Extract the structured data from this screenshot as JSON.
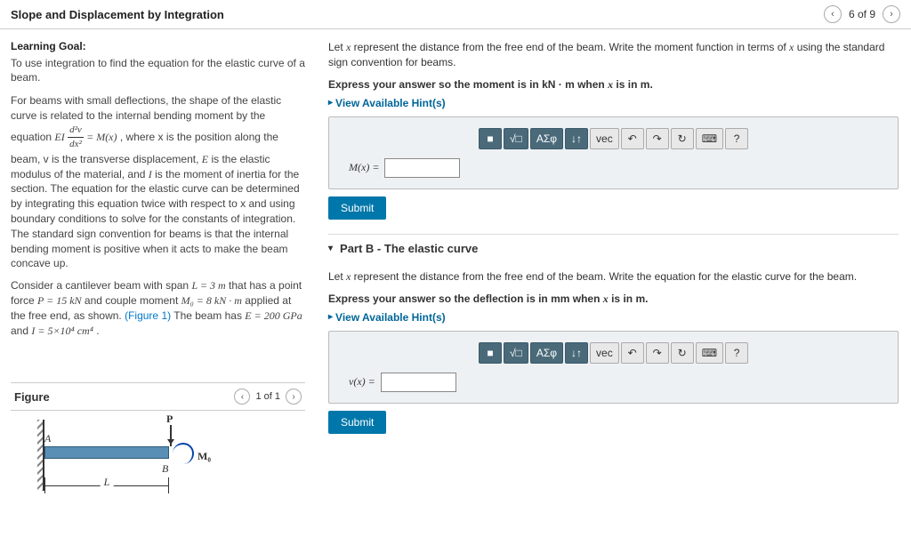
{
  "header": {
    "title": "Slope and Displacement by Integration",
    "progress": "6 of 9"
  },
  "learning_goal": {
    "title": "Learning Goal:",
    "text": "To use integration to find the equation for the elastic curve of a beam."
  },
  "theory": {
    "p1_a": "For beams with small deflections, the shape of the elastic curve is related to the internal bending moment by the equation ",
    "p1_eq_lhs": "EI",
    "p1_eq_num": "d²v",
    "p1_eq_den": "dx²",
    "p1_eq_rhs": " = M(x)",
    "p1_b": ", where x is the position along the beam, v is the transverse displacement, ",
    "p1_E": "E",
    "p1_c": " is the elastic modulus of the material, and ",
    "p1_I": "I",
    "p1_d": " is the moment of inertia for the section. The equation for the elastic curve can be determined by integrating this equation twice with respect to x and using boundary conditions to solve for the constants of integration. The standard sign convention for beams is that the internal bending moment is positive when it acts to make the beam concave up.",
    "p2_a": "Consider a cantilever beam with span ",
    "p2_L": "L = 3 m",
    "p2_b": " that has a point force ",
    "p2_P": "P = 15 kN",
    "p2_c": " and couple moment ",
    "p2_M0": "M₀ = 8 kN · m",
    "p2_d": " applied at the free end, as shown. ",
    "p2_fig": "(Figure 1)",
    "p2_e": "The beam has ",
    "p2_E2": "E = 200 GPa",
    "p2_f": " and ",
    "p2_I2": "I = 5×10⁴ cm⁴",
    "p2_g": " ."
  },
  "figure": {
    "title": "Figure",
    "nav": "1 of 1",
    "labels": {
      "A": "A",
      "B": "B",
      "P": "P",
      "M0": "M₀",
      "L": "L"
    }
  },
  "partA": {
    "prompt_a": "Let ",
    "var": "x",
    "prompt_b": " represent the distance from the free end of the beam. Write the moment function in terms of ",
    "prompt_c": " using the standard sign convention for beams.",
    "instruction_a": "Express your answer so the moment is in kN · m when ",
    "instruction_b": " is in m.",
    "hints": "View Available Hint(s)",
    "input_label": "M(x) = ",
    "submit": "Submit"
  },
  "partB": {
    "title": "Part B - The elastic curve",
    "prompt_a": "Let ",
    "var": "x",
    "prompt_b": " represent the distance from the free end of the beam. Write the equation for the elastic curve for the beam.",
    "instruction_a": "Express your answer so the deflection is in mm when ",
    "instruction_b": " is in m.",
    "hints": "View Available Hint(s)",
    "input_label": "v(x) = ",
    "submit": "Submit"
  },
  "toolbar": {
    "templates": "■",
    "sqrt": "√□",
    "greek": "ΑΣφ",
    "arrows": "↓↑",
    "vec": "vec",
    "undo": "↶",
    "redo": "↷",
    "reset": "↻",
    "keyboard": "⌨",
    "help": "?"
  }
}
